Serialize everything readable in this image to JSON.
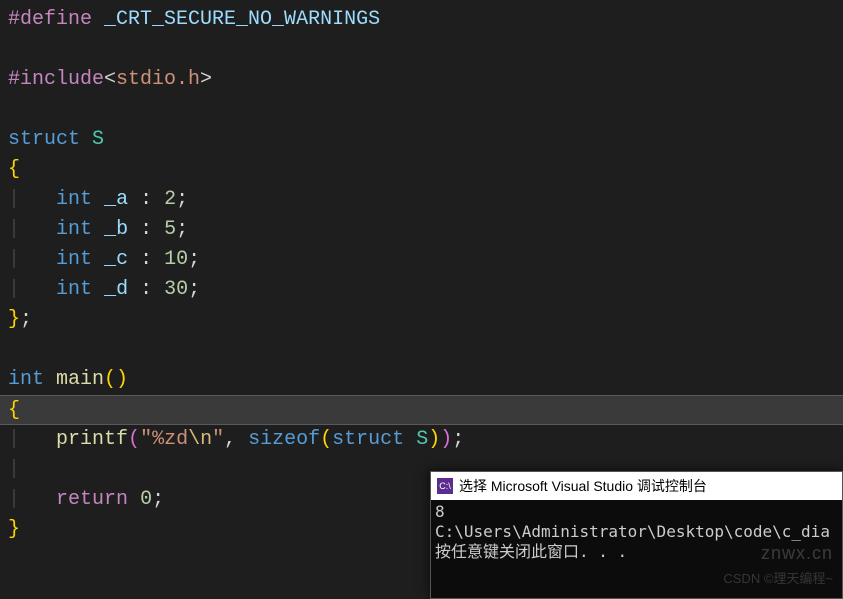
{
  "code": {
    "l1_define": "#define",
    "l1_macro": "_CRT_SECURE_NO_WARNINGS",
    "l3_include": "#include",
    "l3_open": "<",
    "l3_header": "stdio.h",
    "l3_close": ">",
    "l5_struct": "struct",
    "l5_name": "S",
    "l6_brace": "{",
    "l7_type": "int",
    "l7_name": "_a",
    "l7_bits": "2",
    "l8_type": "int",
    "l8_name": "_b",
    "l8_bits": "5",
    "l9_type": "int",
    "l9_name": "_c",
    "l9_bits": "10",
    "l10_type": "int",
    "l10_name": "_d",
    "l10_bits": "30",
    "l11_close": "};",
    "l13_type": "int",
    "l13_func": "main",
    "l13_parens": "()",
    "l14_brace": "{",
    "l15_func": "printf",
    "l15_popen": "(",
    "l15_str_open": "\"",
    "l15_fmt": "%zd",
    "l15_esc": "\\n",
    "l15_str_close": "\"",
    "l15_comma": ", ",
    "l15_sizeof": "sizeof",
    "l15_p2open": "(",
    "l15_struct": "struct",
    "l15_sname": "S",
    "l15_p2close": ")",
    "l15_pclose": ")",
    "l15_semi": ";",
    "l17_return": "return",
    "l17_val": "0",
    "l17_semi": ";",
    "l18_brace": "}"
  },
  "console": {
    "icon_text": "C:\\",
    "title": "选择 Microsoft Visual Studio 调试控制台",
    "output": "8",
    "blank": "",
    "path": "C:\\Users\\Administrator\\Desktop\\code\\c_dia",
    "prompt": "按任意键关闭此窗口. . ."
  },
  "watermark1": "znwx.cn",
  "watermark2": "CSDN ©理天编程~"
}
